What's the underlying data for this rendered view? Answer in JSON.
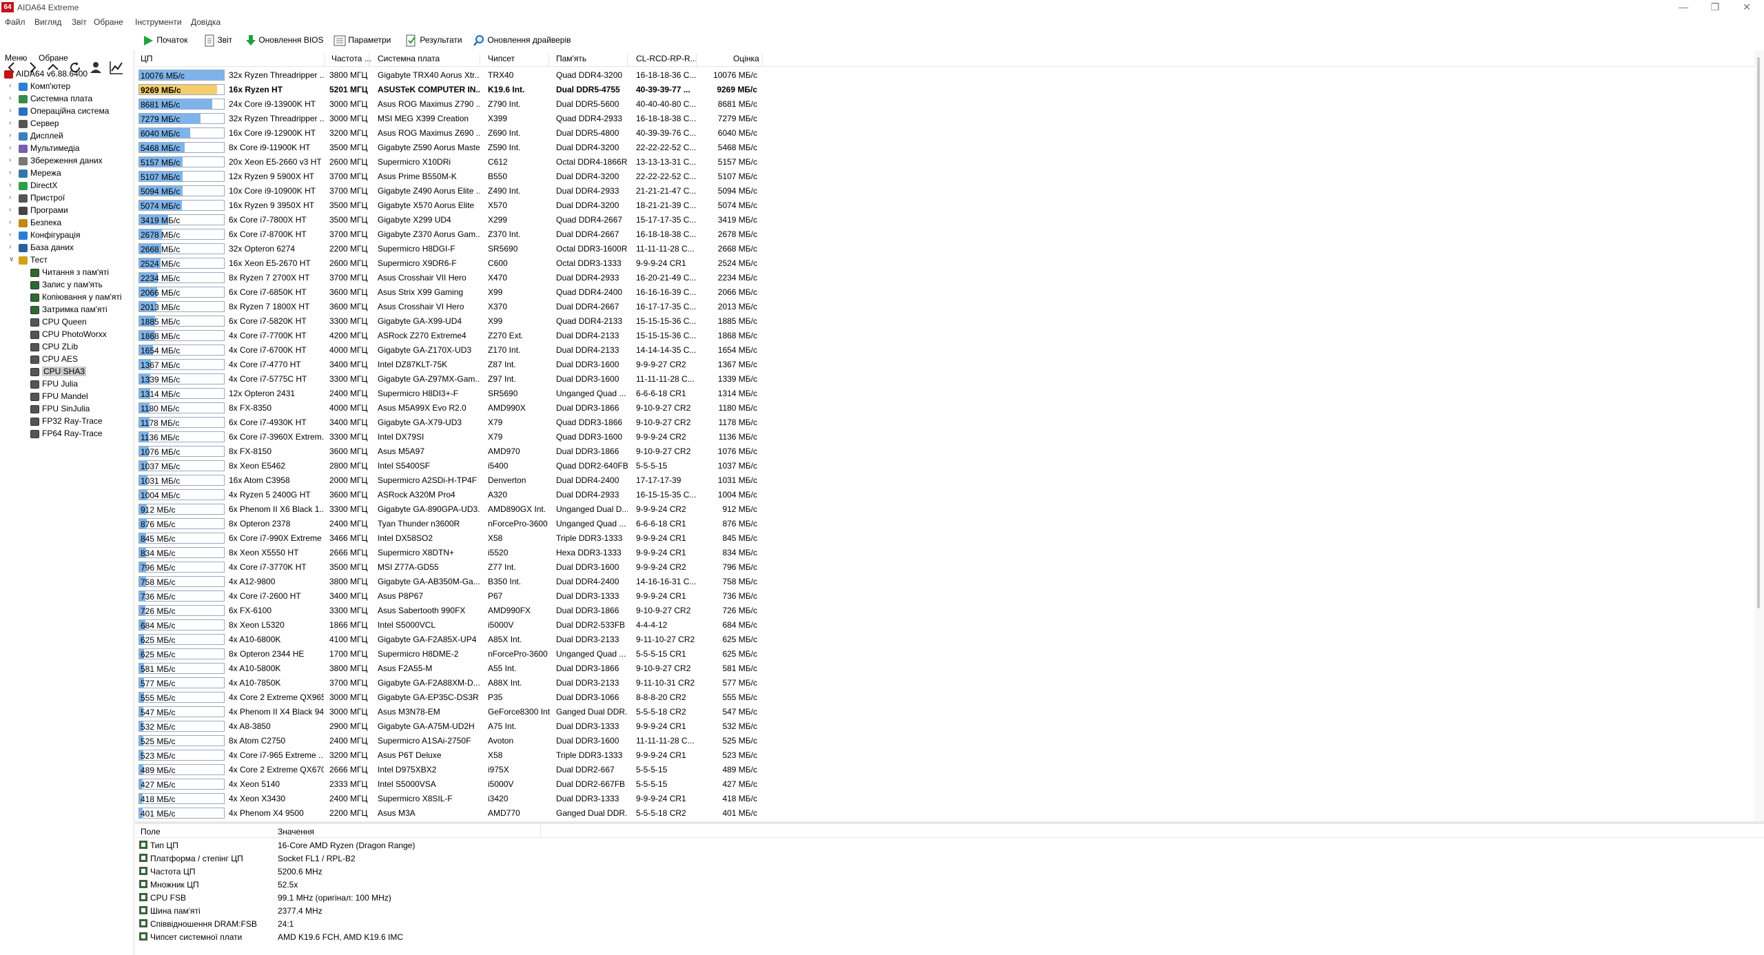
{
  "window": {
    "title": "AIDA64 Extreme",
    "icon_text": "64"
  },
  "menu": [
    "Файл",
    "Вигляд",
    "Звіт",
    "Обране",
    "Інструменти",
    "Довідка"
  ],
  "toolbar": {
    "start": "Початок",
    "report": "Звіт",
    "bios": "Оновлення BIOS",
    "params": "Параметри",
    "results": "Результати",
    "drivers": "Оновлення драйверів"
  },
  "left_tabs": {
    "menu": "Меню",
    "favorites": "Обране"
  },
  "tree": {
    "root": "AIDA64 v6.88.6400",
    "categories": [
      "Комп'ютер",
      "Системна плата",
      "Операційна система",
      "Сервер",
      "Дисплей",
      "Мультимедіа",
      "Збереження даних",
      "Мережа",
      "DirectX",
      "Пристрої",
      "Програми",
      "Безпека",
      "Конфігурація",
      "База даних",
      "Тест"
    ],
    "tests": [
      "Читання з пам'яті",
      "Запис у пам'ять",
      "Копіювання у пам'яті",
      "Затримка пам'яті",
      "CPU Queen",
      "CPU PhotoWorxx",
      "CPU ZLib",
      "CPU AES",
      "CPU SHA3",
      "FPU Julia",
      "FPU Mandel",
      "FPU SinJulia",
      "FP32 Ray-Trace",
      "FP64 Ray-Trace"
    ],
    "selected": "CPU SHA3"
  },
  "grid": {
    "headers": [
      "ЦП",
      "Частота ...",
      "Системна плата",
      "Чипсет",
      "Пам'ять",
      "CL-RCD-RP-R...",
      "Оцінка"
    ],
    "max_value": 10076,
    "rows": [
      {
        "v": 10076,
        "bar": "10076 МБ/с",
        "cpu": "32x Ryzen Threadripper ...",
        "freq": "3800 МГЦ",
        "mb": "Gigabyte TRX40 Aorus Xtr...",
        "chip": "TRX40",
        "mem": "Quad DDR4-3200",
        "tim": "16-18-18-36 C...",
        "score": "10076 МБ/с"
      },
      {
        "v": 9269,
        "bar": "9269 МБ/с",
        "cpu": "16x Ryzen HT",
        "freq": "5201 МГЦ",
        "mb": "ASUSTeK COMPUTER IN...",
        "chip": "K19.6 Int.",
        "mem": "Dual DDR5-4755",
        "tim": "40-39-39-77 ...",
        "score": "9269 МБ/с",
        "hl": true
      },
      {
        "v": 8681,
        "bar": "8681 МБ/с",
        "cpu": "24x Core i9-13900K HT",
        "freq": "3000 МГЦ",
        "mb": "Asus ROG Maximus Z790 ...",
        "chip": "Z790 Int.",
        "mem": "Dual DDR5-5600",
        "tim": "40-40-40-80 C...",
        "score": "8681 МБ/с"
      },
      {
        "v": 7279,
        "bar": "7279 МБ/с",
        "cpu": "32x Ryzen Threadripper ...",
        "freq": "3000 МГЦ",
        "mb": "MSI MEG X399 Creation",
        "chip": "X399",
        "mem": "Quad DDR4-2933",
        "tim": "16-18-18-38 C...",
        "score": "7279 МБ/с"
      },
      {
        "v": 6040,
        "bar": "6040 МБ/с",
        "cpu": "16x Core i9-12900K HT",
        "freq": "3200 МГЦ",
        "mb": "Asus ROG Maximus Z690 ...",
        "chip": "Z690 Int.",
        "mem": "Dual DDR5-4800",
        "tim": "40-39-39-76 C...",
        "score": "6040 МБ/с"
      },
      {
        "v": 5468,
        "bar": "5468 МБ/с",
        "cpu": "8x Core i9-11900K HT",
        "freq": "3500 МГЦ",
        "mb": "Gigabyte Z590 Aorus Master",
        "chip": "Z590 Int.",
        "mem": "Dual DDR4-3200",
        "tim": "22-22-22-52 C...",
        "score": "5468 МБ/с"
      },
      {
        "v": 5157,
        "bar": "5157 МБ/с",
        "cpu": "20x Xeon E5-2660 v3 HT",
        "freq": "2600 МГЦ",
        "mb": "Supermicro X10DRi",
        "chip": "C612",
        "mem": "Octal DDR4-1866R",
        "tim": "13-13-13-31 C...",
        "score": "5157 МБ/с"
      },
      {
        "v": 5107,
        "bar": "5107 МБ/с",
        "cpu": "12x Ryzen 9 5900X HT",
        "freq": "3700 МГЦ",
        "mb": "Asus Prime B550M-K",
        "chip": "B550",
        "mem": "Dual DDR4-3200",
        "tim": "22-22-22-52 C...",
        "score": "5107 МБ/с"
      },
      {
        "v": 5094,
        "bar": "5094 МБ/с",
        "cpu": "10x Core i9-10900K HT",
        "freq": "3700 МГЦ",
        "mb": "Gigabyte Z490 Aorus Elite ...",
        "chip": "Z490 Int.",
        "mem": "Dual DDR4-2933",
        "tim": "21-21-21-47 C...",
        "score": "5094 МБ/с"
      },
      {
        "v": 5074,
        "bar": "5074 МБ/с",
        "cpu": "16x Ryzen 9 3950X HT",
        "freq": "3500 МГЦ",
        "mb": "Gigabyte X570 Aorus Elite",
        "chip": "X570",
        "mem": "Dual DDR4-3200",
        "tim": "18-21-21-39 C...",
        "score": "5074 МБ/с"
      },
      {
        "v": 3419,
        "bar": "3419 МБ/с",
        "cpu": "6x Core i7-7800X HT",
        "freq": "3500 МГЦ",
        "mb": "Gigabyte X299 UD4",
        "chip": "X299",
        "mem": "Quad DDR4-2667",
        "tim": "15-17-17-35 C...",
        "score": "3419 МБ/с"
      },
      {
        "v": 2678,
        "bar": "2678 МБ/с",
        "cpu": "6x Core i7-8700K HT",
        "freq": "3700 МГЦ",
        "mb": "Gigabyte Z370 Aorus Gam...",
        "chip": "Z370 Int.",
        "mem": "Dual DDR4-2667",
        "tim": "16-18-18-38 C...",
        "score": "2678 МБ/с"
      },
      {
        "v": 2668,
        "bar": "2668 МБ/с",
        "cpu": "32x Opteron 6274",
        "freq": "2200 МГЦ",
        "mb": "Supermicro H8DGI-F",
        "chip": "SR5690",
        "mem": "Octal DDR3-1600R",
        "tim": "11-11-11-28 C...",
        "score": "2668 МБ/с"
      },
      {
        "v": 2524,
        "bar": "2524 МБ/с",
        "cpu": "16x Xeon E5-2670 HT",
        "freq": "2600 МГЦ",
        "mb": "Supermicro X9DR6-F",
        "chip": "C600",
        "mem": "Octal DDR3-1333",
        "tim": "9-9-9-24 CR1",
        "score": "2524 МБ/с"
      },
      {
        "v": 2234,
        "bar": "2234 МБ/с",
        "cpu": "8x Ryzen 7 2700X HT",
        "freq": "3700 МГЦ",
        "mb": "Asus Crosshair VII Hero",
        "chip": "X470",
        "mem": "Dual DDR4-2933",
        "tim": "16-20-21-49 C...",
        "score": "2234 МБ/с"
      },
      {
        "v": 2066,
        "bar": "2066 МБ/с",
        "cpu": "6x Core i7-6850K HT",
        "freq": "3600 МГЦ",
        "mb": "Asus Strix X99 Gaming",
        "chip": "X99",
        "mem": "Quad DDR4-2400",
        "tim": "16-16-16-39 C...",
        "score": "2066 МБ/с"
      },
      {
        "v": 2013,
        "bar": "2013 МБ/с",
        "cpu": "8x Ryzen 7 1800X HT",
        "freq": "3600 МГЦ",
        "mb": "Asus Crosshair VI Hero",
        "chip": "X370",
        "mem": "Dual DDR4-2667",
        "tim": "16-17-17-35 C...",
        "score": "2013 МБ/с"
      },
      {
        "v": 1885,
        "bar": "1885 МБ/с",
        "cpu": "6x Core i7-5820K HT",
        "freq": "3300 МГЦ",
        "mb": "Gigabyte GA-X99-UD4",
        "chip": "X99",
        "mem": "Quad DDR4-2133",
        "tim": "15-15-15-36 C...",
        "score": "1885 МБ/с"
      },
      {
        "v": 1868,
        "bar": "1868 МБ/с",
        "cpu": "4x Core i7-7700K HT",
        "freq": "4200 МГЦ",
        "mb": "ASRock Z270 Extreme4",
        "chip": "Z270 Ext.",
        "mem": "Dual DDR4-2133",
        "tim": "15-15-15-36 C...",
        "score": "1868 МБ/с"
      },
      {
        "v": 1654,
        "bar": "1654 МБ/с",
        "cpu": "4x Core i7-6700K HT",
        "freq": "4000 МГЦ",
        "mb": "Gigabyte GA-Z170X-UD3",
        "chip": "Z170 Int.",
        "mem": "Dual DDR4-2133",
        "tim": "14-14-14-35 C...",
        "score": "1654 МБ/с"
      },
      {
        "v": 1367,
        "bar": "1367 МБ/с",
        "cpu": "4x Core i7-4770 HT",
        "freq": "3400 МГЦ",
        "mb": "Intel DZ87KLT-75K",
        "chip": "Z87 Int.",
        "mem": "Dual DDR3-1600",
        "tim": "9-9-9-27 CR2",
        "score": "1367 МБ/с"
      },
      {
        "v": 1339,
        "bar": "1339 МБ/с",
        "cpu": "4x Core i7-5775C HT",
        "freq": "3300 МГЦ",
        "mb": "Gigabyte GA-Z97MX-Gam...",
        "chip": "Z97 Int.",
        "mem": "Dual DDR3-1600",
        "tim": "11-11-11-28 C...",
        "score": "1339 МБ/с"
      },
      {
        "v": 1314,
        "bar": "1314 МБ/с",
        "cpu": "12x Opteron 2431",
        "freq": "2400 МГЦ",
        "mb": "Supermicro H8DI3+-F",
        "chip": "SR5690",
        "mem": "Unganged Quad ...",
        "tim": "6-6-6-18 CR1",
        "score": "1314 МБ/с"
      },
      {
        "v": 1180,
        "bar": "1180 МБ/с",
        "cpu": "8x FX-8350",
        "freq": "4000 МГЦ",
        "mb": "Asus M5A99X Evo R2.0",
        "chip": "AMD990X",
        "mem": "Dual DDR3-1866",
        "tim": "9-10-9-27 CR2",
        "score": "1180 МБ/с"
      },
      {
        "v": 1178,
        "bar": "1178 МБ/с",
        "cpu": "6x Core i7-4930K HT",
        "freq": "3400 МГЦ",
        "mb": "Gigabyte GA-X79-UD3",
        "chip": "X79",
        "mem": "Quad DDR3-1866",
        "tim": "9-10-9-27 CR2",
        "score": "1178 МБ/с"
      },
      {
        "v": 1136,
        "bar": "1136 МБ/с",
        "cpu": "6x Core i7-3960X Extrem...",
        "freq": "3300 МГЦ",
        "mb": "Intel DX79SI",
        "chip": "X79",
        "mem": "Quad DDR3-1600",
        "tim": "9-9-9-24 CR2",
        "score": "1136 МБ/с"
      },
      {
        "v": 1076,
        "bar": "1076 МБ/с",
        "cpu": "8x FX-8150",
        "freq": "3600 МГЦ",
        "mb": "Asus M5A97",
        "chip": "AMD970",
        "mem": "Dual DDR3-1866",
        "tim": "9-10-9-27 CR2",
        "score": "1076 МБ/с"
      },
      {
        "v": 1037,
        "bar": "1037 МБ/с",
        "cpu": "8x Xeon E5462",
        "freq": "2800 МГЦ",
        "mb": "Intel S5400SF",
        "chip": "i5400",
        "mem": "Quad DDR2-640FB",
        "tim": "5-5-5-15",
        "score": "1037 МБ/с"
      },
      {
        "v": 1031,
        "bar": "1031 МБ/с",
        "cpu": "16x Atom C3958",
        "freq": "2000 МГЦ",
        "mb": "Supermicro A2SDi-H-TP4F",
        "chip": "Denverton",
        "mem": "Dual DDR4-2400",
        "tim": "17-17-17-39",
        "score": "1031 МБ/с"
      },
      {
        "v": 1004,
        "bar": "1004 МБ/с",
        "cpu": "4x Ryzen 5 2400G HT",
        "freq": "3600 МГЦ",
        "mb": "ASRock A320M Pro4",
        "chip": "A320",
        "mem": "Dual DDR4-2933",
        "tim": "16-15-15-35 C...",
        "score": "1004 МБ/с"
      },
      {
        "v": 912,
        "bar": "912 МБ/с",
        "cpu": "6x Phenom II X6 Black 1...",
        "freq": "3300 МГЦ",
        "mb": "Gigabyte GA-890GPA-UD3...",
        "chip": "AMD890GX Int.",
        "mem": "Unganged Dual D...",
        "tim": "9-9-9-24 CR2",
        "score": "912 МБ/с"
      },
      {
        "v": 876,
        "bar": "876 МБ/с",
        "cpu": "8x Opteron 2378",
        "freq": "2400 МГЦ",
        "mb": "Tyan Thunder n3600R",
        "chip": "nForcePro-3600",
        "mem": "Unganged Quad ...",
        "tim": "6-6-6-18 CR1",
        "score": "876 МБ/с"
      },
      {
        "v": 845,
        "bar": "845 МБ/с",
        "cpu": "6x Core i7-990X Extreme ...",
        "freq": "3466 МГЦ",
        "mb": "Intel DX58SO2",
        "chip": "X58",
        "mem": "Triple DDR3-1333",
        "tim": "9-9-9-24 CR1",
        "score": "845 МБ/с"
      },
      {
        "v": 834,
        "bar": "834 МБ/с",
        "cpu": "8x Xeon X5550 HT",
        "freq": "2666 МГЦ",
        "mb": "Supermicro X8DTN+",
        "chip": "i5520",
        "mem": "Hexa DDR3-1333",
        "tim": "9-9-9-24 CR1",
        "score": "834 МБ/с"
      },
      {
        "v": 796,
        "bar": "796 МБ/с",
        "cpu": "4x Core i7-3770K HT",
        "freq": "3500 МГЦ",
        "mb": "MSI Z77A-GD55",
        "chip": "Z77 Int.",
        "mem": "Dual DDR3-1600",
        "tim": "9-9-9-24 CR2",
        "score": "796 МБ/с"
      },
      {
        "v": 758,
        "bar": "758 МБ/с",
        "cpu": "4x A12-9800",
        "freq": "3800 МГЦ",
        "mb": "Gigabyte GA-AB350M-Ga...",
        "chip": "B350 Int.",
        "mem": "Dual DDR4-2400",
        "tim": "14-16-16-31 C...",
        "score": "758 МБ/с"
      },
      {
        "v": 736,
        "bar": "736 МБ/с",
        "cpu": "4x Core i7-2600 HT",
        "freq": "3400 МГЦ",
        "mb": "Asus P8P67",
        "chip": "P67",
        "mem": "Dual DDR3-1333",
        "tim": "9-9-9-24 CR1",
        "score": "736 МБ/с"
      },
      {
        "v": 726,
        "bar": "726 МБ/с",
        "cpu": "6x FX-6100",
        "freq": "3300 МГЦ",
        "mb": "Asus Sabertooth 990FX",
        "chip": "AMD990FX",
        "mem": "Dual DDR3-1866",
        "tim": "9-10-9-27 CR2",
        "score": "726 МБ/с"
      },
      {
        "v": 684,
        "bar": "684 МБ/с",
        "cpu": "8x Xeon L5320",
        "freq": "1866 МГЦ",
        "mb": "Intel S5000VCL",
        "chip": "i5000V",
        "mem": "Dual DDR2-533FB",
        "tim": "4-4-4-12",
        "score": "684 МБ/с"
      },
      {
        "v": 625,
        "bar": "625 МБ/с",
        "cpu": "4x A10-6800K",
        "freq": "4100 МГЦ",
        "mb": "Gigabyte GA-F2A85X-UP4",
        "chip": "A85X Int.",
        "mem": "Dual DDR3-2133",
        "tim": "9-11-10-27 CR2",
        "score": "625 МБ/с"
      },
      {
        "v": 625,
        "bar": "625 МБ/с",
        "cpu": "8x Opteron 2344 HE",
        "freq": "1700 МГЦ",
        "mb": "Supermicro H8DME-2",
        "chip": "nForcePro-3600",
        "mem": "Unganged Quad ...",
        "tim": "5-5-5-15 CR1",
        "score": "625 МБ/с"
      },
      {
        "v": 581,
        "bar": "581 МБ/с",
        "cpu": "4x A10-5800K",
        "freq": "3800 МГЦ",
        "mb": "Asus F2A55-M",
        "chip": "A55 Int.",
        "mem": "Dual DDR3-1866",
        "tim": "9-10-9-27 CR2",
        "score": "581 МБ/с"
      },
      {
        "v": 577,
        "bar": "577 МБ/с",
        "cpu": "4x A10-7850K",
        "freq": "3700 МГЦ",
        "mb": "Gigabyte GA-F2A88XM-D...",
        "chip": "A88X Int.",
        "mem": "Dual DDR3-2133",
        "tim": "9-11-10-31 CR2",
        "score": "577 МБ/с"
      },
      {
        "v": 555,
        "bar": "555 МБ/с",
        "cpu": "4x Core 2 Extreme QX9650",
        "freq": "3000 МГЦ",
        "mb": "Gigabyte GA-EP35C-DS3R",
        "chip": "P35",
        "mem": "Dual DDR3-1066",
        "tim": "8-8-8-20 CR2",
        "score": "555 МБ/с"
      },
      {
        "v": 547,
        "bar": "547 МБ/с",
        "cpu": "4x Phenom II X4 Black 940",
        "freq": "3000 МГЦ",
        "mb": "Asus M3N78-EM",
        "chip": "GeForce8300 Int.",
        "mem": "Ganged Dual DDR...",
        "tim": "5-5-5-18 CR2",
        "score": "547 МБ/с"
      },
      {
        "v": 532,
        "bar": "532 МБ/с",
        "cpu": "4x A8-3850",
        "freq": "2900 МГЦ",
        "mb": "Gigabyte GA-A75M-UD2H",
        "chip": "A75 Int.",
        "mem": "Dual DDR3-1333",
        "tim": "9-9-9-24 CR1",
        "score": "532 МБ/с"
      },
      {
        "v": 525,
        "bar": "525 МБ/с",
        "cpu": "8x Atom C2750",
        "freq": "2400 МГЦ",
        "mb": "Supermicro A1SAi-2750F",
        "chip": "Avoton",
        "mem": "Dual DDR3-1600",
        "tim": "11-11-11-28 C...",
        "score": "525 МБ/с"
      },
      {
        "v": 523,
        "bar": "523 МБ/с",
        "cpu": "4x Core i7-965 Extreme ...",
        "freq": "3200 МГЦ",
        "mb": "Asus P6T Deluxe",
        "chip": "X58",
        "mem": "Triple DDR3-1333",
        "tim": "9-9-9-24 CR1",
        "score": "523 МБ/с"
      },
      {
        "v": 489,
        "bar": "489 МБ/с",
        "cpu": "4x Core 2 Extreme QX6700",
        "freq": "2666 МГЦ",
        "mb": "Intel D975XBX2",
        "chip": "i975X",
        "mem": "Dual DDR2-667",
        "tim": "5-5-5-15",
        "score": "489 МБ/с"
      },
      {
        "v": 427,
        "bar": "427 МБ/с",
        "cpu": "4x Xeon 5140",
        "freq": "2333 МГЦ",
        "mb": "Intel S5000VSA",
        "chip": "i5000V",
        "mem": "Dual DDR2-667FB",
        "tim": "5-5-5-15",
        "score": "427 МБ/с"
      },
      {
        "v": 418,
        "bar": "418 МБ/с",
        "cpu": "4x Xeon X3430",
        "freq": "2400 МГЦ",
        "mb": "Supermicro X8SIL-F",
        "chip": "i3420",
        "mem": "Dual DDR3-1333",
        "tim": "9-9-9-24 CR1",
        "score": "418 МБ/с"
      },
      {
        "v": 401,
        "bar": "401 МБ/с",
        "cpu": "4x Phenom X4 9500",
        "freq": "2200 МГЦ",
        "mb": "Asus M3A",
        "chip": "AMD770",
        "mem": "Ganged Dual DDR...",
        "tim": "5-5-5-18 CR2",
        "score": "401 МБ/с"
      }
    ]
  },
  "details": {
    "headers": [
      "Поле",
      "Значення"
    ],
    "rows": [
      {
        "f": "Тип ЦП",
        "v": "16-Core AMD Ryzen  (Dragon Range)"
      },
      {
        "f": "Платформа / степінг ЦП",
        "v": "Socket FL1 / RPL-B2"
      },
      {
        "f": "Частота ЦП",
        "v": "5200.6 MHz"
      },
      {
        "f": "Множник ЦП",
        "v": "52.5x"
      },
      {
        "f": "CPU FSB",
        "v": "99.1 MHz  (оригінал:  100 MHz)"
      },
      {
        "f": "Шина пам'яті",
        "v": "2377.4 MHz"
      },
      {
        "f": "Співвідношення DRAM:FSB",
        "v": "24:1"
      },
      {
        "f": "Чипсет системної плати",
        "v": "AMD K19.6 FCH, AMD K19.6 IMC"
      }
    ]
  },
  "colors": {
    "bar_fill": "#7eb4ea",
    "bar_highlight": "#f5cd6c",
    "app_icon": "#c0151b"
  }
}
